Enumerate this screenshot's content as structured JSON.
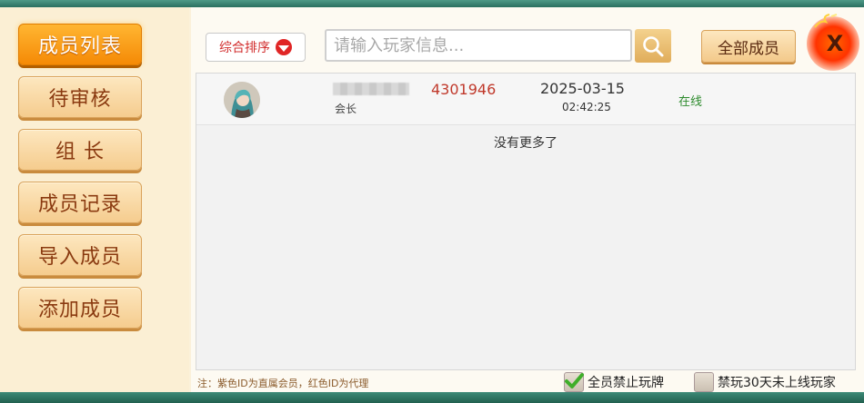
{
  "sidebar": {
    "items": [
      {
        "label": "成员列表",
        "active": true
      },
      {
        "label": "待审核"
      },
      {
        "label": "组 长"
      },
      {
        "label": "成员记录"
      },
      {
        "label": "导入成员"
      },
      {
        "label": "添加成员"
      }
    ]
  },
  "toolbar": {
    "sort_label": "综合排序",
    "search_placeholder": "请输入玩家信息...",
    "search_value": "",
    "all_members_label": "全部成员",
    "close_label": "X"
  },
  "members": [
    {
      "uid": "4301946",
      "role": "会长",
      "date": "2025-03-15",
      "time": "02:42:25",
      "status": "在线"
    }
  ],
  "list_end_text": "没有更多了",
  "footer": {
    "note": "注：紫色ID为直属会员，红色ID为代理",
    "ban_all_label": "全员禁止玩牌",
    "ban_all_checked": true,
    "ban_inactive_label": "禁玩30天未上线玩家",
    "ban_inactive_checked": false
  },
  "colors": {
    "accent_orange": "#f58a05",
    "uid_red": "#c0392b",
    "online_green": "#2e8b2e",
    "frame_teal": "#2e7d6d"
  }
}
